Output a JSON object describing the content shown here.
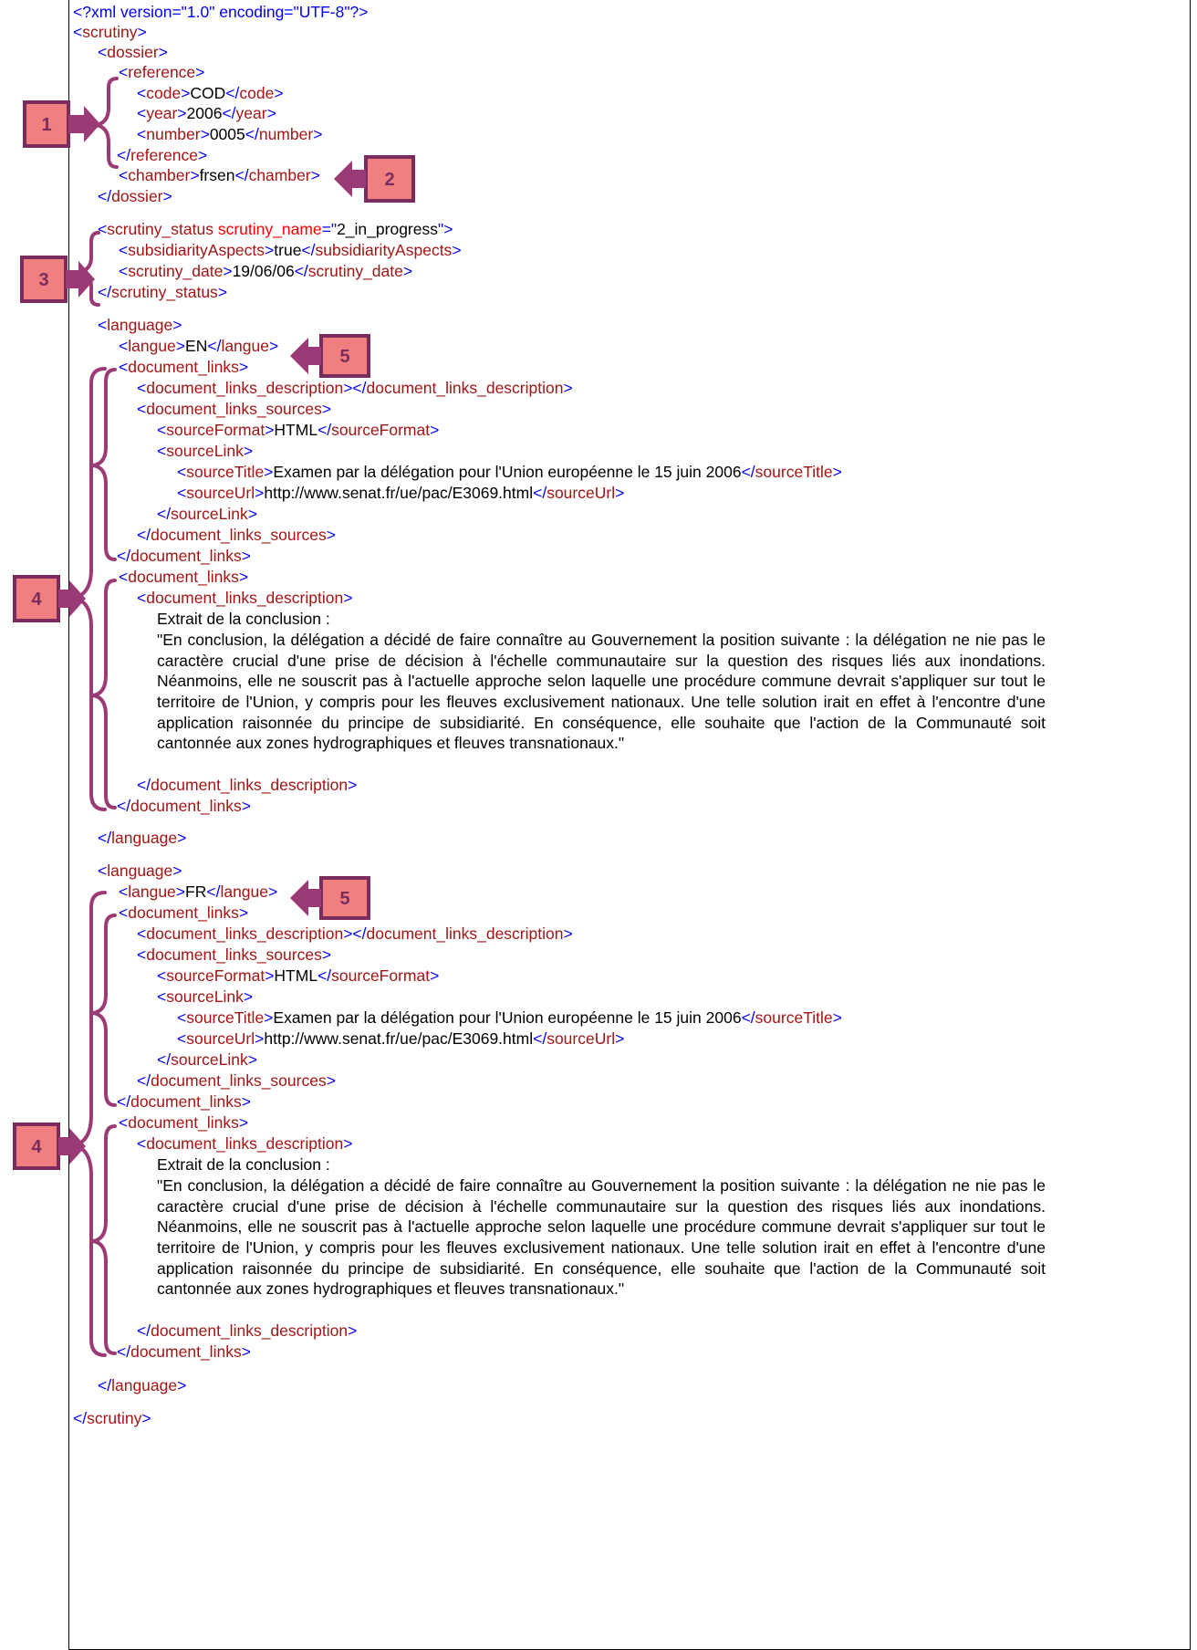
{
  "xml": {
    "declaration": "<?xml version=\"1.0\" encoding=\"UTF-8\"?>",
    "root_open": "scrutiny",
    "root_close": "scrutiny",
    "dossier": {
      "tag": "dossier",
      "reference_tag": "reference",
      "code_tag": "code",
      "code": "COD",
      "year_tag": "year",
      "year": "2006",
      "number_tag": "number",
      "number": "0005",
      "chamber_tag": "chamber",
      "chamber": "frsen"
    },
    "scrutiny_status": {
      "tag": "scrutiny_status",
      "attr_name": "scrutiny_name",
      "attr_value": "2_in_progress",
      "subsidiarity_tag": "subsidiarityAspects",
      "subsidiarity": "true",
      "date_tag": "scrutiny_date",
      "date": "19/06/06"
    },
    "languages": [
      {
        "tag": "language",
        "langue_tag": "langue",
        "langue": "EN",
        "links_tag": "document_links",
        "desc_tag": "document_links_description",
        "sources_tag": "document_links_sources",
        "format_tag": "sourceFormat",
        "format": "HTML",
        "link_tag": "sourceLink",
        "title_tag": "sourceTitle",
        "title": "Examen par la délégation pour l'Union européenne le 15 juin 2006",
        "url_tag": "sourceUrl",
        "url": "http://www.senat.fr/ue/pac/E3069.html",
        "excerpt_head": "Extrait de la conclusion :",
        "excerpt": "\"En conclusion, la délégation a décidé de faire connaître au Gouvernement la position suivante : la délégation ne nie pas le caractère crucial d'une prise de décision à l'échelle communautaire sur la question des risques liés aux inondations. Néanmoins, elle ne souscrit pas à l'actuelle approche selon laquelle une procédure commune devrait s'appliquer sur tout le territoire de l'Union, y compris pour les fleuves exclusivement nationaux. Une telle solution irait en effet à l'encontre d'une application raisonnée du principe de subsidiarité. En conséquence, elle souhaite que l'action de la Communauté soit cantonnée aux zones hydrographiques et fleuves transnationaux.\""
      },
      {
        "tag": "language",
        "langue_tag": "langue",
        "langue": "FR",
        "links_tag": "document_links",
        "desc_tag": "document_links_description",
        "sources_tag": "document_links_sources",
        "format_tag": "sourceFormat",
        "format": "HTML",
        "link_tag": "sourceLink",
        "title_tag": "sourceTitle",
        "title": "Examen par la délégation pour l'Union européenne le 15 juin 2006",
        "url_tag": "sourceUrl",
        "url": "http://www.senat.fr/ue/pac/E3069.html",
        "excerpt_head": "Extrait de la conclusion :",
        "excerpt": "\"En conclusion, la délégation a décidé de faire connaître au Gouvernement la position suivante : la délégation ne nie pas le caractère crucial d'une prise de décision à l'échelle communautaire sur la question des risques liés aux inondations. Néanmoins, elle ne souscrit pas à l'actuelle approche selon laquelle une procédure commune devrait s'appliquer sur tout le territoire de l'Union, y compris pour les fleuves exclusivement nationaux. Une telle solution irait en effet à l'encontre d'une application raisonnée du principe de subsidiarité. En conséquence, elle souhaite que l'action de la Communauté soit cantonnée aux zones hydrographiques et fleuves transnationaux.\""
      }
    ]
  },
  "callouts": {
    "b1": "1",
    "b2": "2",
    "b3": "3",
    "b4": "4",
    "b5": "5"
  },
  "colors": {
    "tag": "#a31515",
    "punct": "#0000ff",
    "badge_fill": "#f08080",
    "badge_border": "#7a2c5e",
    "brace": "#9b3b75"
  }
}
